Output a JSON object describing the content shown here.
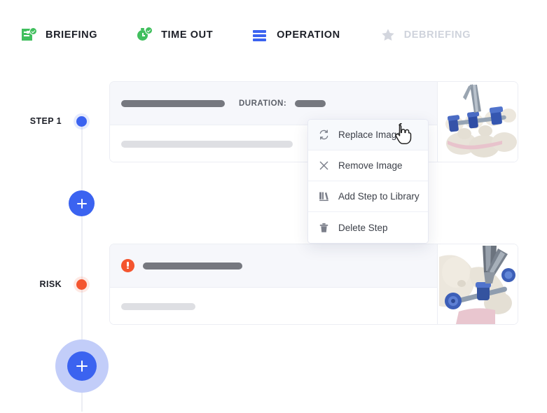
{
  "nav": {
    "items": [
      {
        "label": "BRIEFING",
        "icon": "clipboard-check-icon",
        "state": "active"
      },
      {
        "label": "TIME OUT",
        "icon": "stopwatch-check-icon",
        "state": "active"
      },
      {
        "label": "OPERATION",
        "icon": "list-bars-icon",
        "state": "active"
      },
      {
        "label": "DEBRIEFING",
        "icon": "star-icon",
        "state": "inactive"
      }
    ]
  },
  "timeline": {
    "step_label": "STEP 1",
    "risk_label": "RISK",
    "add_step_button": "+",
    "add_section_button": "+",
    "step_dot_color": "#3b63f0",
    "risk_dot_color": "#f4552f"
  },
  "cards": [
    {
      "type": "step",
      "title_placeholder": "",
      "duration_label": "DURATION:",
      "duration_value_placeholder": "",
      "description_placeholder": "",
      "menu_button": "…",
      "thumbnail": "spinal-fusion-rods-illustration"
    },
    {
      "type": "risk",
      "alert_icon": "alert-exclamation-icon",
      "title_placeholder": "",
      "description_placeholder": "",
      "menu_button": "…",
      "thumbnail": "pelvic-fixation-screws-illustration"
    }
  ],
  "context_menu": {
    "items": [
      {
        "label": "Replace Image",
        "icon": "refresh-sync-icon",
        "hovered": true
      },
      {
        "label": "Remove Image",
        "icon": "close-x-icon",
        "hovered": false
      },
      {
        "label": "Add Step to Library",
        "icon": "library-books-icon",
        "hovered": false
      },
      {
        "label": "Delete Step",
        "icon": "trash-icon",
        "hovered": false
      }
    ]
  },
  "cursor": {
    "icon": "pointer-hand-cursor"
  },
  "colors": {
    "accent_blue": "#3b63f0",
    "accent_green": "#41bf5e",
    "accent_red": "#f4552f",
    "muted": "#cfd3dc"
  }
}
